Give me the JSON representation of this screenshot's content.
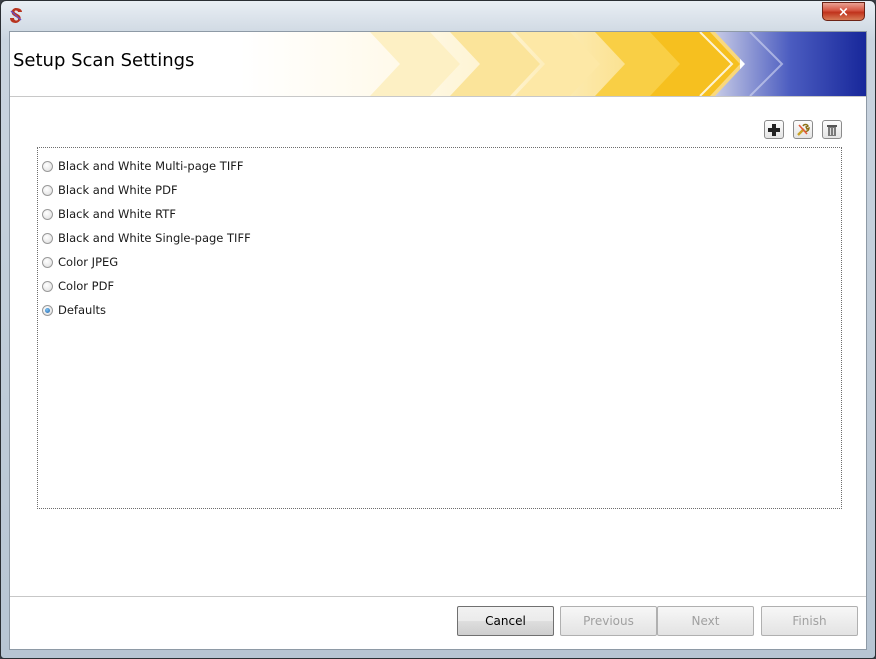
{
  "window": {
    "title": "",
    "close_glyph": "×",
    "icon": "app-logo-icon"
  },
  "banner": {
    "title": "Setup Scan Settings"
  },
  "toolbar": {
    "add_icon": "plus-icon",
    "edit_icon": "tools-icon",
    "delete_icon": "trash-icon"
  },
  "options": [
    {
      "label": "Black and White Multi-page TIFF",
      "checked": false
    },
    {
      "label": "Black and White PDF",
      "checked": false
    },
    {
      "label": "Black and White RTF",
      "checked": false
    },
    {
      "label": "Black and White Single-page TIFF",
      "checked": false
    },
    {
      "label": "Color JPEG",
      "checked": false
    },
    {
      "label": "Color PDF",
      "checked": false
    },
    {
      "label": "Defaults",
      "checked": true
    }
  ],
  "footer": {
    "cancel": "Cancel",
    "previous": "Previous",
    "next": "Next",
    "finish": "Finish"
  },
  "colors": {
    "banner_yellow": "#f7c62a",
    "banner_blue": "#1b2e9e"
  }
}
